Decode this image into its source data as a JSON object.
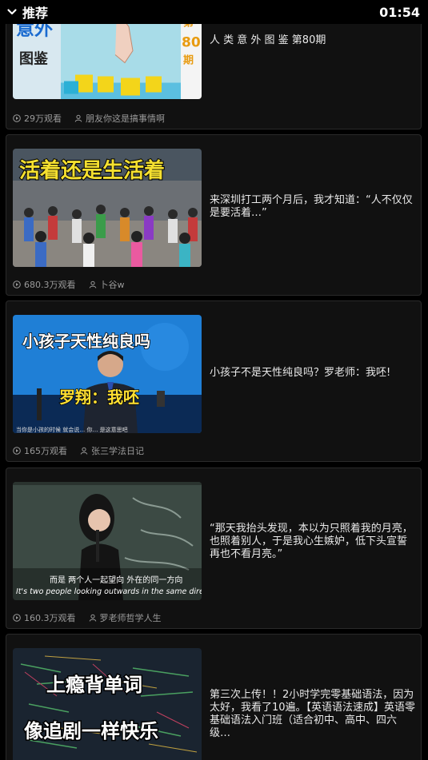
{
  "header": {
    "title": "推荐",
    "time": "01:54"
  },
  "cards": [
    {
      "title": "人 类 意 外 图 鉴 第80期",
      "views": "29万观看",
      "author": "朋友你这是搞事情啊",
      "thumb_text": [
        "意外",
        "图鉴",
        "第",
        "80",
        "期"
      ]
    },
    {
      "title": "来深圳打工两个月后，我才知道：“人不仅仅是要活着…”",
      "views": "680.3万观看",
      "author": "卜谷w",
      "thumb_text": [
        "活着还是生活着"
      ]
    },
    {
      "title": "小孩子不是天性纯良吗？罗老师：我呸!",
      "views": "165万观看",
      "author": "张三学法日记",
      "thumb_text": [
        "小孩子天性纯良吗",
        "罗翔：我呸",
        "当你是小孩的时候 就会说… 你… 是这意思吧"
      ]
    },
    {
      "title": "“那天我抬头发现，本以为只照着我的月亮，也照着别人，于是我心生嫉妒，低下头宣誓再也不看月亮。”",
      "views": "160.3万观看",
      "author": "罗老师哲学人生",
      "thumb_text": [
        "而是 两个人一起望向 外在的同一方向",
        "It's two people looking outwards in the same direc"
      ]
    },
    {
      "title": "第三次上传！！2小时学完零基础语法，因为太好，我看了10遍。【英语语法速成】英语零基础语法入门班（适合初中、高中、四六级…",
      "views": "",
      "author": "",
      "thumb_text": [
        "上瘾背单词",
        "像追剧一样快乐"
      ]
    }
  ],
  "colors": {
    "bg": "#000000",
    "card": "#111111",
    "border": "#2a2a2a",
    "meta": "#9a9a9a"
  }
}
